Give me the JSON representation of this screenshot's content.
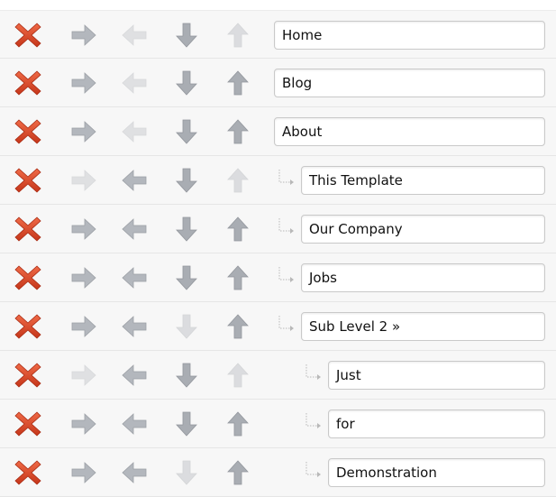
{
  "icons": {
    "delete": "delete-x-icon",
    "indent": "arrow-right-icon",
    "outdent": "arrow-left-icon",
    "move_down": "arrow-down-icon",
    "move_up": "arrow-up-icon",
    "connector": "tree-connector-icon"
  },
  "colors": {
    "delete_red": "#d9411e",
    "arrow_gray": "#a9adb3",
    "row_bg": "#f7f7f7",
    "border": "#c9c9c9"
  },
  "menu_items": [
    {
      "title": "Home",
      "level": 0,
      "indent_enabled": true,
      "outdent_enabled": false,
      "down_enabled": true,
      "up_enabled": false
    },
    {
      "title": "Blog",
      "level": 0,
      "indent_enabled": true,
      "outdent_enabled": false,
      "down_enabled": true,
      "up_enabled": true
    },
    {
      "title": "About",
      "level": 0,
      "indent_enabled": true,
      "outdent_enabled": false,
      "down_enabled": true,
      "up_enabled": true
    },
    {
      "title": "This Template",
      "level": 1,
      "indent_enabled": false,
      "outdent_enabled": true,
      "down_enabled": true,
      "up_enabled": false
    },
    {
      "title": "Our Company",
      "level": 1,
      "indent_enabled": true,
      "outdent_enabled": true,
      "down_enabled": true,
      "up_enabled": true
    },
    {
      "title": "Jobs",
      "level": 1,
      "indent_enabled": true,
      "outdent_enabled": true,
      "down_enabled": true,
      "up_enabled": true
    },
    {
      "title": "Sub Level 2 »",
      "level": 1,
      "indent_enabled": true,
      "outdent_enabled": true,
      "down_enabled": false,
      "up_enabled": true
    },
    {
      "title": "Just",
      "level": 2,
      "indent_enabled": false,
      "outdent_enabled": true,
      "down_enabled": true,
      "up_enabled": false
    },
    {
      "title": "for",
      "level": 2,
      "indent_enabled": true,
      "outdent_enabled": true,
      "down_enabled": true,
      "up_enabled": true
    },
    {
      "title": "Demonstration",
      "level": 2,
      "indent_enabled": true,
      "outdent_enabled": true,
      "down_enabled": false,
      "up_enabled": true
    }
  ]
}
